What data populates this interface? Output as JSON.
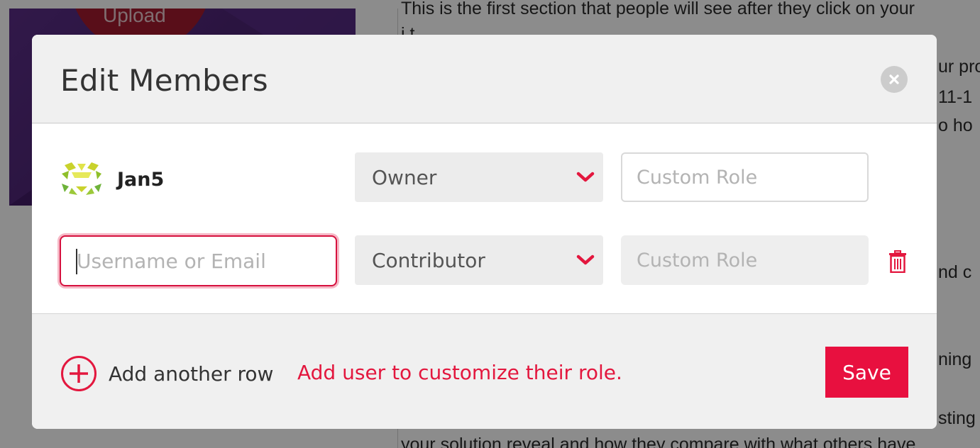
{
  "background": {
    "upload_label": "Upload",
    "text_lines": [
      "This is the first section that people will see after they click on your",
      "i t",
      "ur pro",
      "11-1",
      "o ho",
      "nd c",
      "ning",
      "sting",
      "your solution reveal and how they compare with what others have"
    ]
  },
  "modal": {
    "title": "Edit Members",
    "members": [
      {
        "name": "Jan5",
        "role": "Owner",
        "custom_role_placeholder": "Custom Role"
      }
    ],
    "new_member": {
      "username_placeholder": "Username or Email",
      "role": "Contributor",
      "custom_role_placeholder": "Custom Role"
    },
    "footer": {
      "add_row_label": "Add another row",
      "hint": "Add user to customize their role.",
      "save_label": "Save"
    }
  },
  "colors": {
    "accent": "#e8103f",
    "hint": "#e3173e",
    "hero": "#4a2370"
  },
  "icons": [
    "close-icon",
    "chevron-down-icon",
    "trash-icon",
    "plus-circle-icon",
    "avatar-identicon"
  ]
}
